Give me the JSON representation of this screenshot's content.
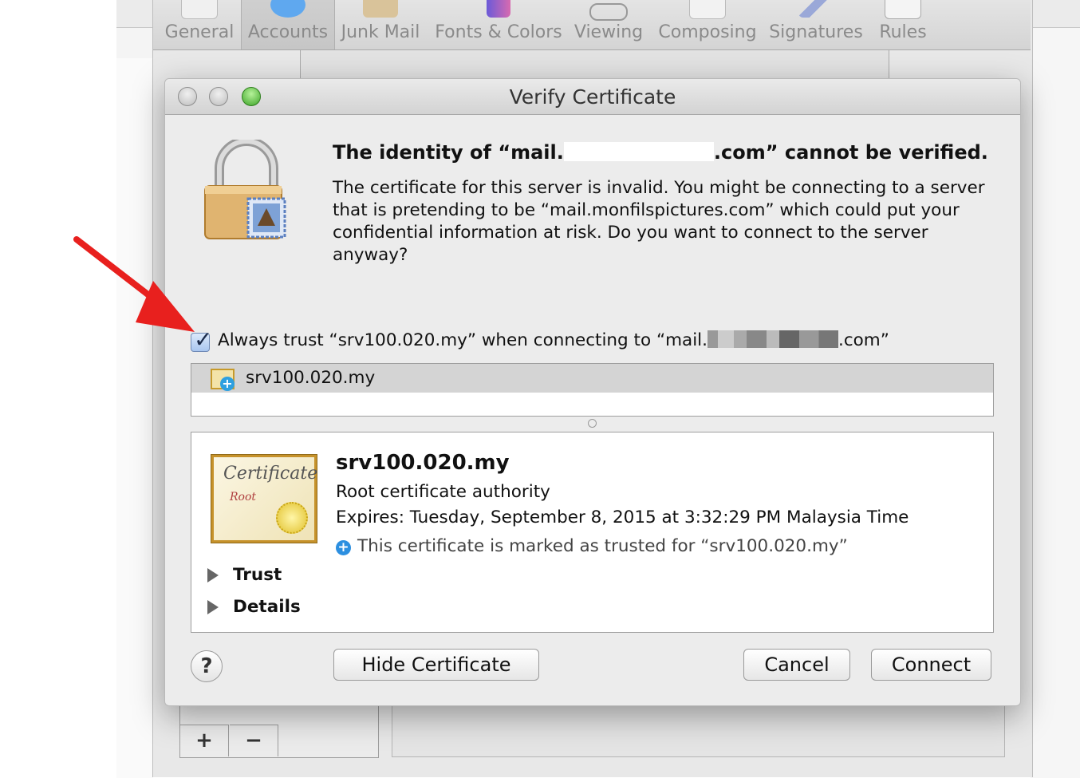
{
  "toolbar": {
    "items": [
      {
        "label": "General",
        "icon": "general-switch-icon"
      },
      {
        "label": "Accounts",
        "icon": "at-sign-icon"
      },
      {
        "label": "Junk Mail",
        "icon": "junk-mail-icon"
      },
      {
        "label": "Fonts & Colors",
        "icon": "fonts-colors-icon"
      },
      {
        "label": "Viewing",
        "icon": "glasses-icon"
      },
      {
        "label": "Composing",
        "icon": "pencil-icon"
      },
      {
        "label": "Signatures",
        "icon": "pen-icon"
      },
      {
        "label": "Rules",
        "icon": "rules-icon"
      }
    ],
    "selected": "Accounts"
  },
  "prefs_bottom": {
    "add_label": "+",
    "remove_label": "−"
  },
  "dialog": {
    "title": "Verify Certificate",
    "heading_prefix": "The identity of “mail.",
    "heading_suffix": ".com” cannot be verified.",
    "body": "The certificate for this server is invalid. You might be connecting to a server that is pretending to be “mail.monfilspictures.com” which could put your confidential information at risk. Do you want to connect to the server anyway?",
    "always_trust_prefix": "Always trust “srv100.020.my” when connecting to “mail.",
    "always_trust_suffix": ".com”",
    "always_trust_checked": true,
    "cert_list": [
      "srv100.020.my"
    ],
    "cert": {
      "name": "srv100.020.my",
      "type": "Root certificate authority",
      "expires": "Expires: Tuesday, September 8, 2015 at 3:32:29 PM Malaysia Time",
      "trust_status": "This certificate is marked as trusted for “srv100.020.my”",
      "badge_word_1": "Certificate",
      "badge_word_2": "Root",
      "sections": [
        "Trust",
        "Details"
      ]
    },
    "buttons": {
      "help": "?",
      "hide_certificate": "Hide Certificate",
      "cancel": "Cancel",
      "connect": "Connect"
    }
  },
  "colors": {
    "annotation_arrow": "#e8201e",
    "trusted_plus": "#2c8fe0",
    "zoom_green": "#3da428"
  }
}
